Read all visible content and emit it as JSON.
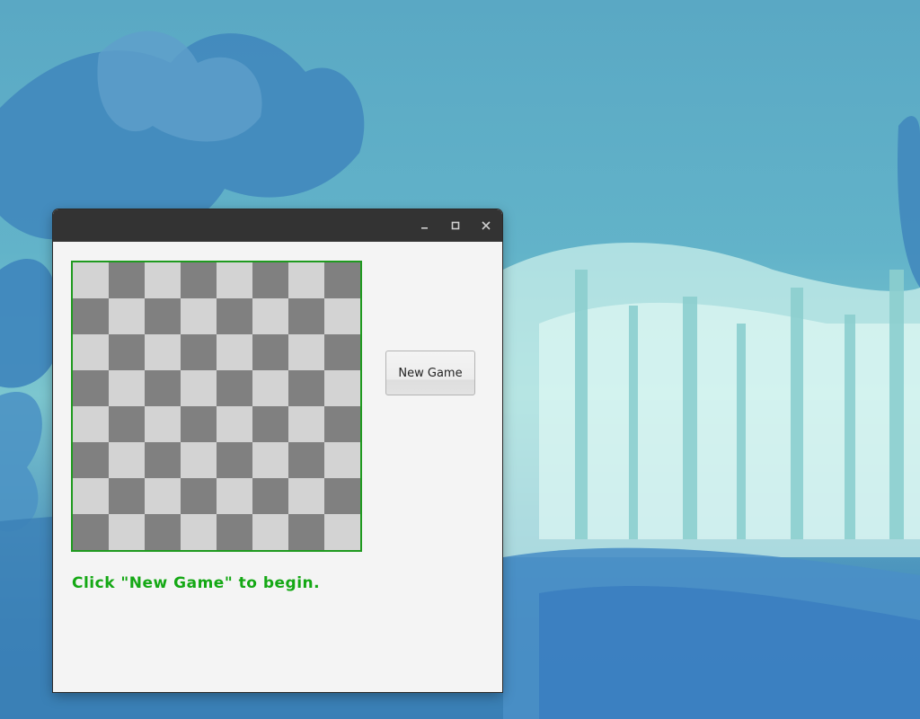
{
  "window": {
    "controls": {
      "minimize_icon": "minimize-icon",
      "maximize_icon": "maximize-icon",
      "close_icon": "close-icon"
    }
  },
  "board": {
    "rows": 8,
    "cols": 8,
    "light_color": "#d3d3d3",
    "dark_color": "#808080",
    "border_color": "#1f9a1f"
  },
  "controls": {
    "new_game_label": "New Game"
  },
  "status": {
    "message": "Click \"New Game\" to begin.",
    "color": "#14a814"
  }
}
